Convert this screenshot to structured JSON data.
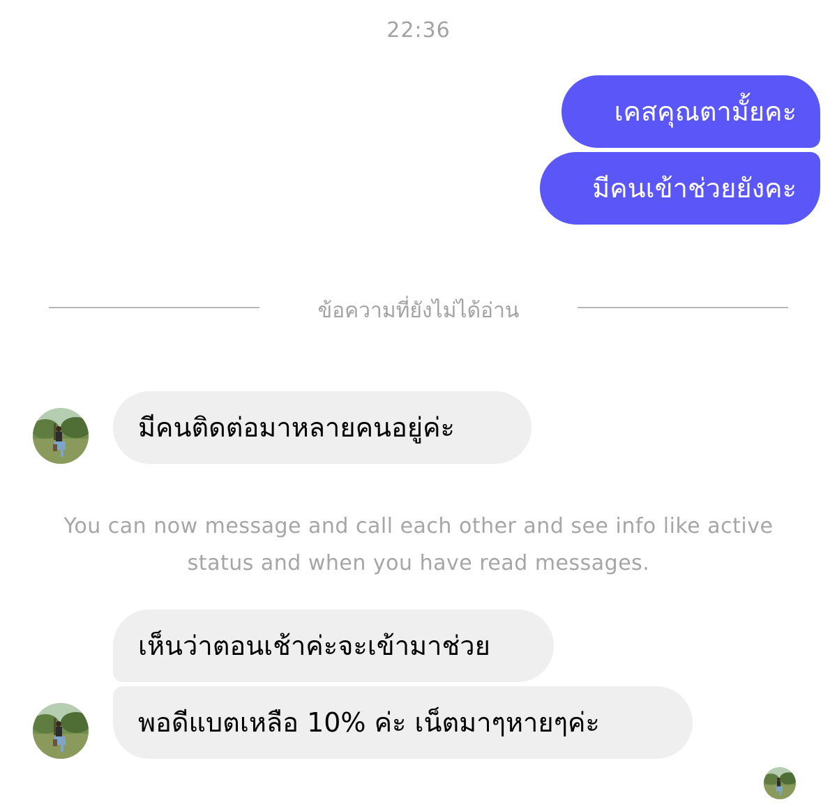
{
  "conversation": {
    "timestamp": "22:36",
    "outgoing": [
      {
        "text": "เคสคุณตามั้ยคะ"
      },
      {
        "text": "มีคนเข้าช่วยยังคะ"
      }
    ],
    "unread_divider": "ข้อความที่ยังไม่ได้อ่าน",
    "incoming_1": {
      "text": "มีคนติดต่อมาหลายคนอยู่ค่ะ"
    },
    "notice": "You can now message and call each other and see info like active status and when you have read messages.",
    "incoming_2": [
      {
        "text": "เห็นว่าตอนเช้าค่ะจะเข้ามาช่วย"
      },
      {
        "text": "พอดีแบตเหลือ 10% ค่ะ เน็ตมาๆหายๆค่ะ"
      }
    ]
  },
  "colors": {
    "outgoing_bubble": "#5a56f7",
    "incoming_bubble": "#efefef",
    "meta_text": "#a3a3a3"
  },
  "icons": {
    "contact_avatar": "contact-avatar-photo",
    "seen_indicator": "seen-avatar-photo"
  }
}
